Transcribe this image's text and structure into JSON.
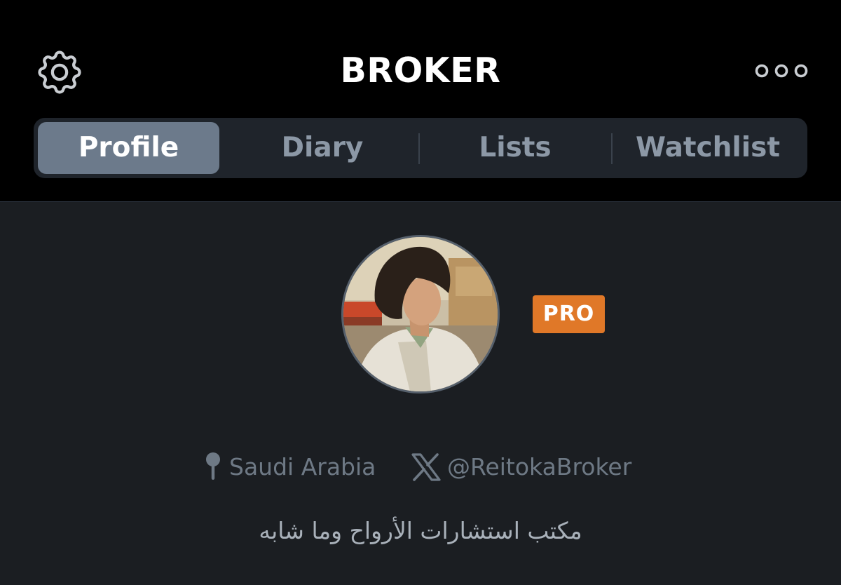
{
  "header": {
    "title": "BROKER",
    "settings_icon": "gear-icon",
    "more_icon": "more-dots-icon"
  },
  "tabs": [
    {
      "label": "Profile",
      "active": true
    },
    {
      "label": "Diary",
      "active": false
    },
    {
      "label": "Lists",
      "active": false
    },
    {
      "label": "Watchlist",
      "active": false
    }
  ],
  "profile": {
    "badge": "PRO",
    "location": "Saudi Arabia",
    "location_icon": "map-pin-icon",
    "social_icon": "x-logo-icon",
    "social_handle": "@ReitokaBroker",
    "bio": "مكتب استشارات الأرواح وما شابه"
  },
  "colors": {
    "background": "#1b1e22",
    "header_background": "#000000",
    "active_tab": "#6c7a8b",
    "pro_badge": "#e07828",
    "muted_text": "#6e7985"
  }
}
